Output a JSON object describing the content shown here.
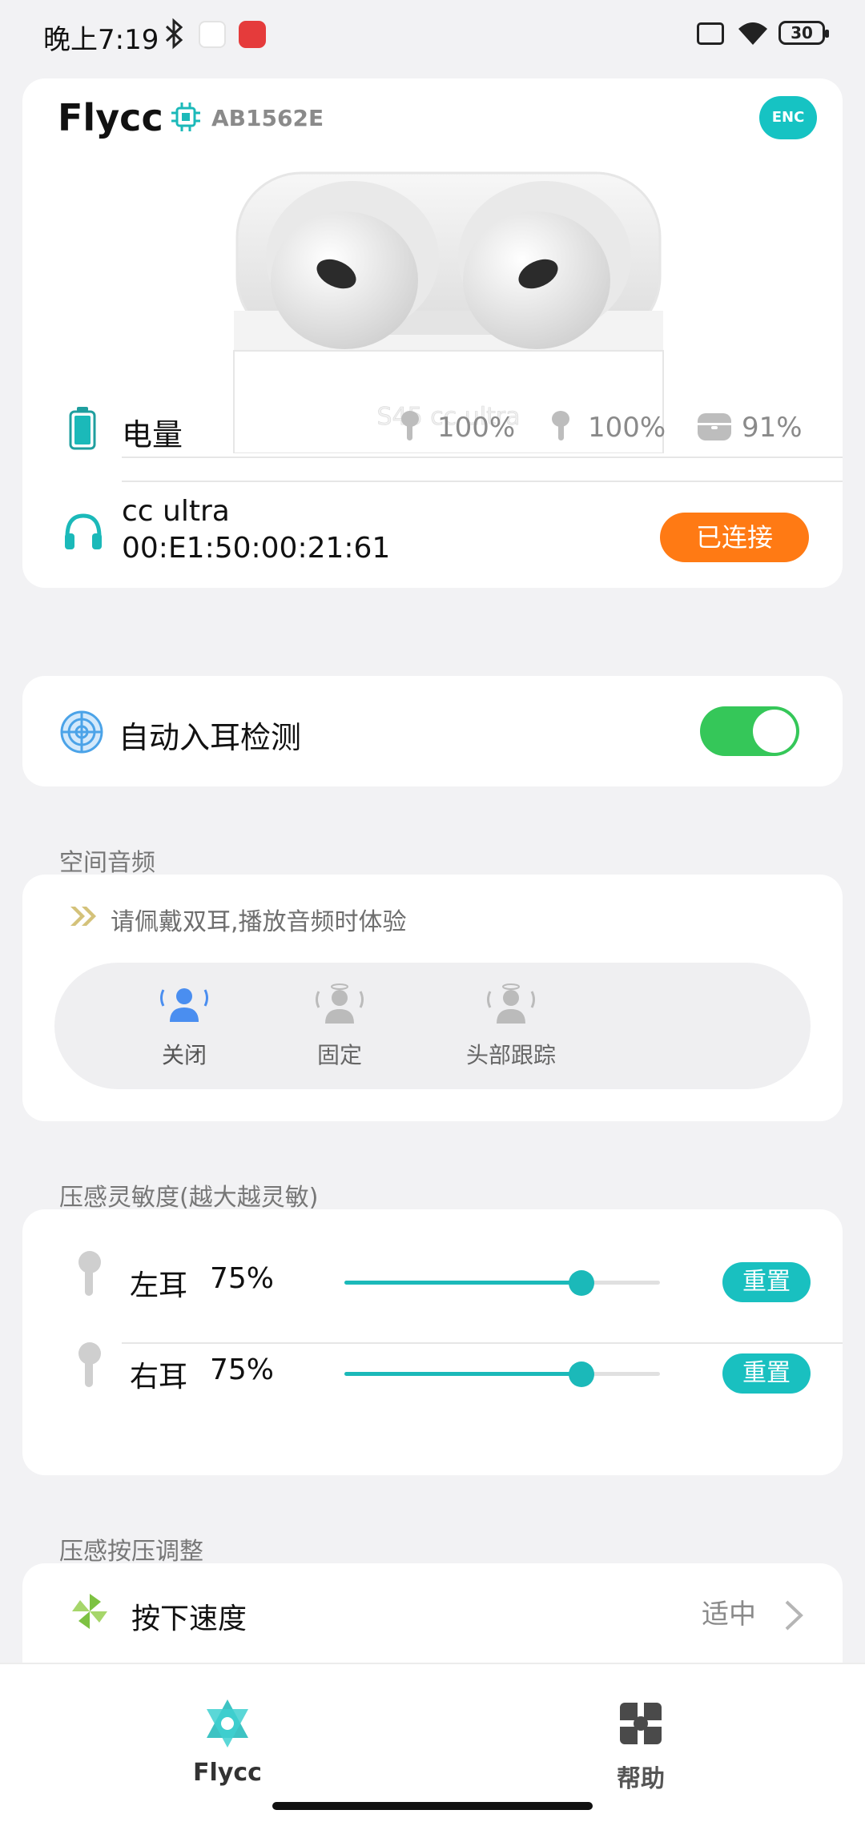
{
  "status_bar": {
    "time": "晚上7:19",
    "battery": "30"
  },
  "device": {
    "name": "Flycc",
    "chip": "AB1562E",
    "enc_badge": "ENC",
    "battery_label": "电量",
    "left_pct": "100%",
    "right_pct": "100%",
    "case_pct": "91%",
    "connection_name": "cc ultra",
    "mac": "00:E1:50:00:21:61",
    "connected_label": "已连接"
  },
  "ear_detect": {
    "label": "自动入耳检测",
    "enabled": true
  },
  "spatial_audio": {
    "title": "空间音频",
    "hint": "请佩戴双耳,播放音频时体验",
    "options": [
      {
        "label": "关闭",
        "selected": true
      },
      {
        "label": "固定",
        "selected": false
      },
      {
        "label": "头部跟踪",
        "selected": false
      }
    ]
  },
  "pressure": {
    "title": "压感灵敏度(越大越灵敏)",
    "rows": [
      {
        "label": "左耳",
        "value": "75%",
        "level": 0.75,
        "reset": "重置"
      },
      {
        "label": "右耳",
        "value": "75%",
        "level": 0.75,
        "reset": "重置"
      }
    ]
  },
  "press_adjust": {
    "title": "压感按压调整",
    "speed_label": "按下速度",
    "speed_value": "适中"
  },
  "nav": {
    "items": [
      {
        "label": "Flycc",
        "active": true
      },
      {
        "label": "帮助",
        "active": false
      }
    ]
  },
  "colors": {
    "accent": "#19c0c0",
    "connected": "#ff7a14",
    "toggle_on": "#35c759"
  }
}
